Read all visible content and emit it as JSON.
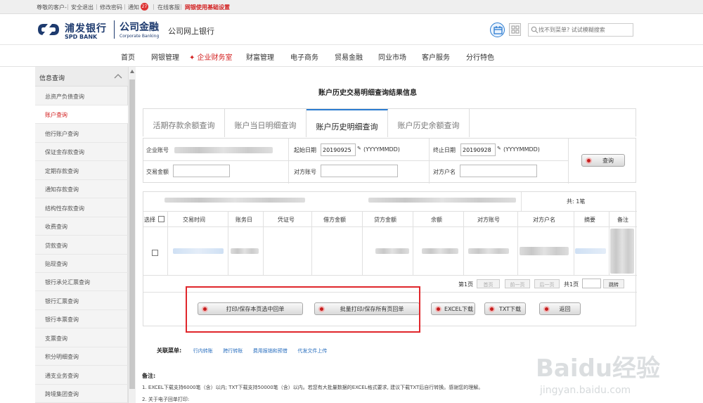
{
  "topbar": {
    "greeting": "尊敬的客户-",
    "logout": "安全退出",
    "change_password": "修改密码",
    "notices": "通知",
    "notice_count": "27",
    "online_service": "在线客服",
    "settings_link": "网银使用基础设置"
  },
  "header": {
    "bank_name_cn": "浦发银行",
    "bank_name_en": "SPD BANK",
    "corp_cn": "公司金融",
    "corp_en": "Corporate Banking",
    "subtitle": "公司网上银行",
    "search_placeholder": "找不到菜单? 试试模糊搜索"
  },
  "nav": {
    "items": [
      "首页",
      "网银管理",
      "✦ 企业财务室",
      "财富管理",
      "电子商务",
      "贸易金融",
      "同业市场",
      "客户服务",
      "分行特色"
    ],
    "active_index": 2
  },
  "sidebar": {
    "title": "信息查询",
    "items": [
      "总资产负债查询",
      "账户查询",
      "他行账户查询",
      "保证金存款查询",
      "定期存款查询",
      "通知存款查询",
      "结构性存款查询",
      "收费查询",
      "贷款查询",
      "贴现查询",
      "银行承兑汇票查询",
      "银行汇票查询",
      "银行本票查询",
      "支票查询",
      "积分明细查询",
      "通支业务查询",
      "跨境集团查询"
    ],
    "active_index": 1
  },
  "main": {
    "title": "账户历史交易明细查询结果信息",
    "tabs": [
      "活期存款余额查询",
      "账户当日明细查询",
      "账户历史明细查询",
      "账户历史余额查询"
    ],
    "active_tab": 2,
    "form": {
      "account_label": "企业账号",
      "start_label": "起始日期",
      "start_value": "20190925",
      "date_format": "(YYYYMMDD)",
      "end_label": "终止日期",
      "end_value": "20190928",
      "amount_label": "交易金额",
      "counter_account_label": "对方账号",
      "counter_name_label": "对方户名",
      "query_button": "查询"
    },
    "results": {
      "total": "共: 1笔",
      "columns": [
        "选择",
        "交易时间",
        "账务日",
        "凭证号",
        "借方金额",
        "贷方金额",
        "余额",
        "对方账号",
        "对方户名",
        "摘要",
        "备注"
      ],
      "pager": {
        "page_label": "第1页",
        "first": "首页",
        "prev": "前一页",
        "next": "后一页",
        "total_pages": "共1页",
        "jump": "跳转"
      }
    },
    "actions": {
      "print_selected": "打印/保存本页选中回单",
      "print_all": "批量打印/保存所有页回单",
      "excel": "EXCEL下载",
      "txt": "TXT下载",
      "back": "返回"
    },
    "related": {
      "label": "关联菜单:",
      "links": [
        "行内转账",
        "跨行转账",
        "费用报销和预借",
        "代发文件上传"
      ]
    },
    "notes": {
      "title": "备注:",
      "line1": "1. EXCEL下载支持6000笔（含）以内; TXT下载支持50000笔（含）以内。若您有大批量数据的EXCEL格式要求, 建议下载TXT后自行转换。感谢您的理解。",
      "line2": "2. 关于电子回单打印:"
    }
  },
  "watermark": {
    "brand": "Baidu经验",
    "url": "jingyan.baidu.com"
  },
  "colors": {
    "accent_red": "#d21d1d",
    "brand_blue": "#1d3a6e",
    "link_blue": "#2a6fbf",
    "highlight_red": "#e0262b"
  }
}
